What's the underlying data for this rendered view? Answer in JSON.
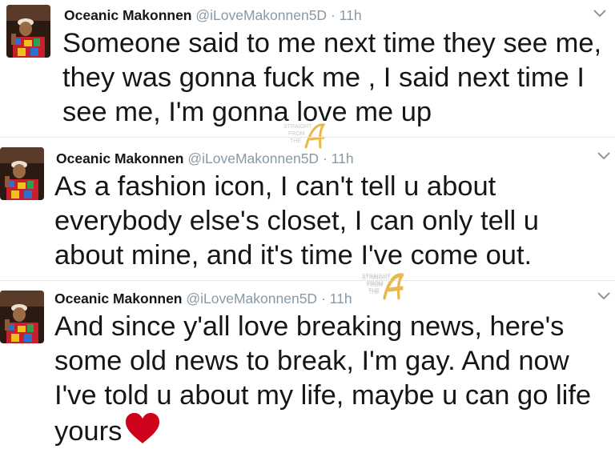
{
  "tweets": [
    {
      "name": "Oceanic Makonnen",
      "handle": "@iLoveMakonnen5D",
      "separator": "·",
      "time": "11h",
      "lines": [
        "Someone said to me next time they see me,",
        "they was gonna fuck me , I said next time I",
        "see me, I'm gonna love me up"
      ]
    },
    {
      "name": "Oceanic Makonnen",
      "handle": "@iLoveMakonnen5D",
      "separator": "·",
      "time": "11h",
      "lines": [
        "As a fashion icon, I can't tell u about",
        "everybody else's closet, I can only tell u",
        "about mine, and it's time I've come out."
      ]
    },
    {
      "name": "Oceanic Makonnen",
      "handle": "@iLoveMakonnen5D",
      "separator": "·",
      "time": "11h",
      "lines": [
        "And since y'all love breaking news, here's",
        "some old news to break, I'm gay. And now",
        "I've told u about my life, maybe u can go life",
        "yours"
      ],
      "trailing_emoji": "red-heart"
    }
  ],
  "watermark": {
    "text_top": "STRAIGHT",
    "text_middle": "FROM",
    "text_bottom": "THE",
    "letter": "A"
  },
  "colors": {
    "name": "#14171a",
    "meta": "#8899a6",
    "divider": "#e1e8ed",
    "heart": "#d0021b",
    "watermark_gold": "#e8b84a"
  }
}
